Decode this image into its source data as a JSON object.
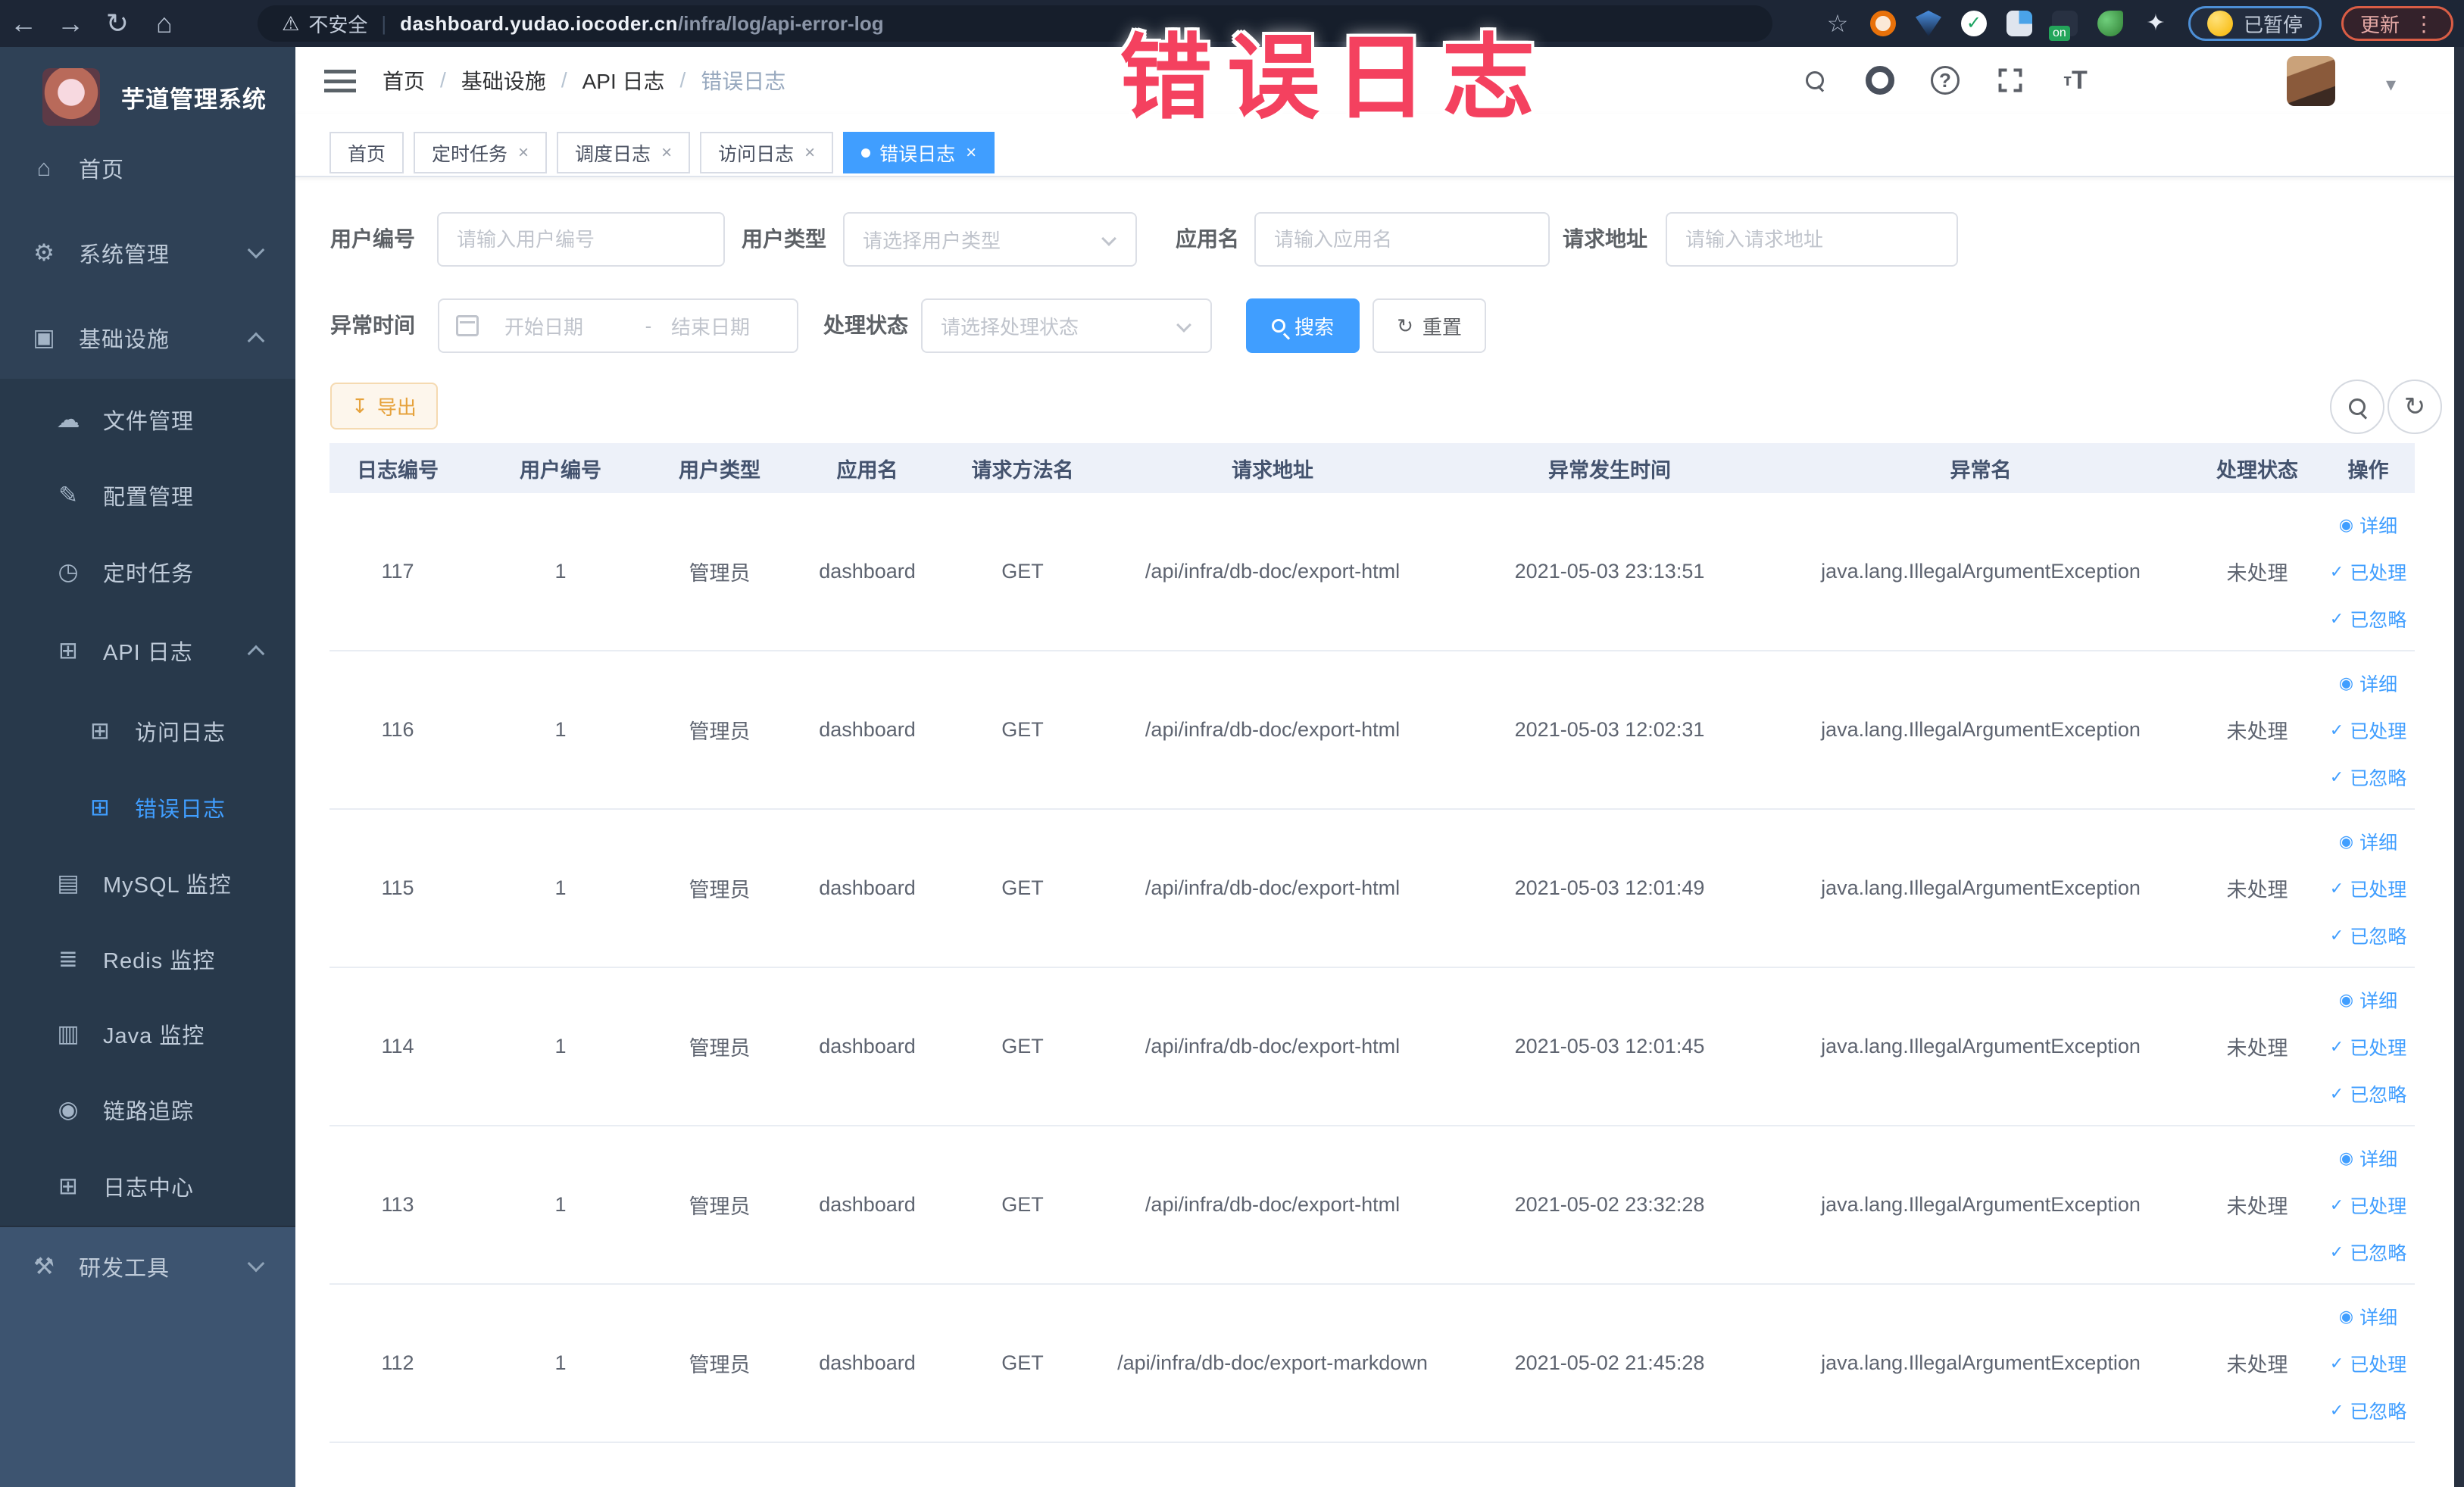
{
  "colors": {
    "accent": "#409EFF",
    "export_warning": "#E6A23C",
    "annotation": "#F4415F",
    "sidebar_bg": "#2F4156"
  },
  "browser": {
    "security_label": "不安全",
    "url_host": "dashboard.yudao.iocoder.cn",
    "url_path": "/infra/log/api-error-log",
    "on_badge": "on",
    "paused_pill": "已暂停",
    "update_pill": "更新"
  },
  "annotation": {
    "text": "错误日志"
  },
  "sidebar": {
    "title": "芋道管理系统",
    "items": [
      {
        "label": "首页",
        "icon": "home",
        "level": 0
      },
      {
        "label": "系统管理",
        "icon": "gear",
        "level": 0,
        "chevron": "down"
      },
      {
        "label": "基础设施",
        "icon": "infra",
        "level": 0,
        "chevron": "up"
      },
      {
        "label": "文件管理",
        "icon": "cloud",
        "level": 1
      },
      {
        "label": "配置管理",
        "icon": "edit",
        "level": 1
      },
      {
        "label": "定时任务",
        "icon": "timer",
        "level": 1
      },
      {
        "label": "API 日志",
        "icon": "log",
        "level": 1,
        "chevron": "up"
      },
      {
        "label": "访问日志",
        "icon": "log",
        "level": 2
      },
      {
        "label": "错误日志",
        "icon": "log",
        "level": 2,
        "active": true
      },
      {
        "label": "MySQL 监控",
        "icon": "monitor",
        "level": 1
      },
      {
        "label": "Redis 监控",
        "icon": "redis",
        "level": 1
      },
      {
        "label": "Java 监控",
        "icon": "java",
        "level": 1
      },
      {
        "label": "链路追踪",
        "icon": "eye",
        "level": 1
      },
      {
        "label": "日志中心",
        "icon": "log",
        "level": 1
      },
      {
        "label": "研发工具",
        "icon": "tools",
        "level": 0,
        "chevron": "down"
      }
    ]
  },
  "header": {
    "breadcrumbs": [
      "首页",
      "基础设施",
      "API 日志",
      "错误日志"
    ]
  },
  "tabs": [
    {
      "label": "首页",
      "closable": false,
      "active": false
    },
    {
      "label": "定时任务",
      "closable": true,
      "active": false
    },
    {
      "label": "调度日志",
      "closable": true,
      "active": false
    },
    {
      "label": "访问日志",
      "closable": true,
      "active": false
    },
    {
      "label": "错误日志",
      "closable": true,
      "active": true
    }
  ],
  "filters": {
    "user_id": {
      "label": "用户编号",
      "placeholder": "请输入用户编号"
    },
    "user_type": {
      "label": "用户类型",
      "placeholder": "请选择用户类型"
    },
    "app_name": {
      "label": "应用名",
      "placeholder": "请输入应用名"
    },
    "request_url": {
      "label": "请求地址",
      "placeholder": "请输入请求地址"
    },
    "exception_time": {
      "label": "异常时间",
      "start_placeholder": "开始日期",
      "separator": "-",
      "end_placeholder": "结束日期"
    },
    "process_status": {
      "label": "处理状态",
      "placeholder": "请选择处理状态"
    },
    "search_label": "搜索",
    "reset_label": "重置"
  },
  "toolbar": {
    "export_label": "导出"
  },
  "table": {
    "columns": [
      "日志编号",
      "用户编号",
      "用户类型",
      "应用名",
      "请求方法名",
      "请求地址",
      "异常发生时间",
      "异常名",
      "处理状态",
      "操作"
    ],
    "row_actions": [
      "详细",
      "已处理",
      "已忽略"
    ],
    "rows": [
      {
        "id": "117",
        "user_id": "1",
        "user_type": "管理员",
        "app_name": "dashboard",
        "method": "GET",
        "url": "/api/infra/db-doc/export-html",
        "time": "2021-05-03 23:13:51",
        "exception": "java.lang.IllegalArgumentException",
        "status": "未处理"
      },
      {
        "id": "116",
        "user_id": "1",
        "user_type": "管理员",
        "app_name": "dashboard",
        "method": "GET",
        "url": "/api/infra/db-doc/export-html",
        "time": "2021-05-03 12:02:31",
        "exception": "java.lang.IllegalArgumentException",
        "status": "未处理"
      },
      {
        "id": "115",
        "user_id": "1",
        "user_type": "管理员",
        "app_name": "dashboard",
        "method": "GET",
        "url": "/api/infra/db-doc/export-html",
        "time": "2021-05-03 12:01:49",
        "exception": "java.lang.IllegalArgumentException",
        "status": "未处理"
      },
      {
        "id": "114",
        "user_id": "1",
        "user_type": "管理员",
        "app_name": "dashboard",
        "method": "GET",
        "url": "/api/infra/db-doc/export-html",
        "time": "2021-05-03 12:01:45",
        "exception": "java.lang.IllegalArgumentException",
        "status": "未处理"
      },
      {
        "id": "113",
        "user_id": "1",
        "user_type": "管理员",
        "app_name": "dashboard",
        "method": "GET",
        "url": "/api/infra/db-doc/export-html",
        "time": "2021-05-02 23:32:28",
        "exception": "java.lang.IllegalArgumentException",
        "status": "未处理"
      },
      {
        "id": "112",
        "user_id": "1",
        "user_type": "管理员",
        "app_name": "dashboard",
        "method": "GET",
        "url": "/api/infra/db-doc/export-markdown",
        "time": "2021-05-02 21:45:28",
        "exception": "java.lang.IllegalArgumentException",
        "status": "未处理"
      }
    ]
  }
}
